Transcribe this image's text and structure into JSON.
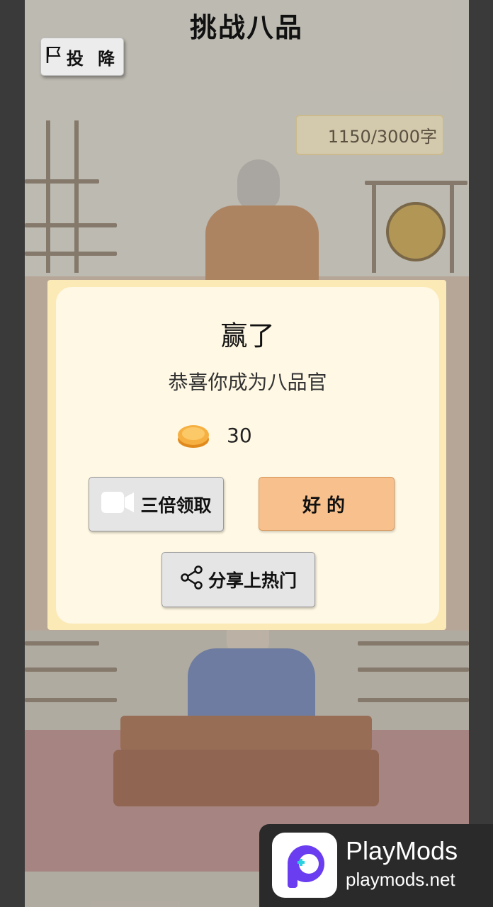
{
  "header": {
    "title": "挑战八品"
  },
  "toolbar": {
    "surrender_label": "投 降",
    "surrender_icon": "flag-icon"
  },
  "progress": {
    "word_count": "1150/3000字"
  },
  "dialog": {
    "title": "赢了",
    "message": "恭喜你成为八品官",
    "reward_value": "30",
    "reward_icon": "coin-icon",
    "triple_button": {
      "label": "三倍领取",
      "icon": "video-icon"
    },
    "ok_button": {
      "label": "好的"
    },
    "share_button": {
      "label": "分享上热门",
      "icon": "share-icon"
    }
  },
  "watermark": {
    "brand": "PlayMods",
    "url": "playmods.net"
  },
  "colors": {
    "dialog_bg": "#fff8e4",
    "dialog_border": "#fbe9b6",
    "ok_button": "#f7c08c",
    "neutral_button": "#e5e5e5"
  }
}
